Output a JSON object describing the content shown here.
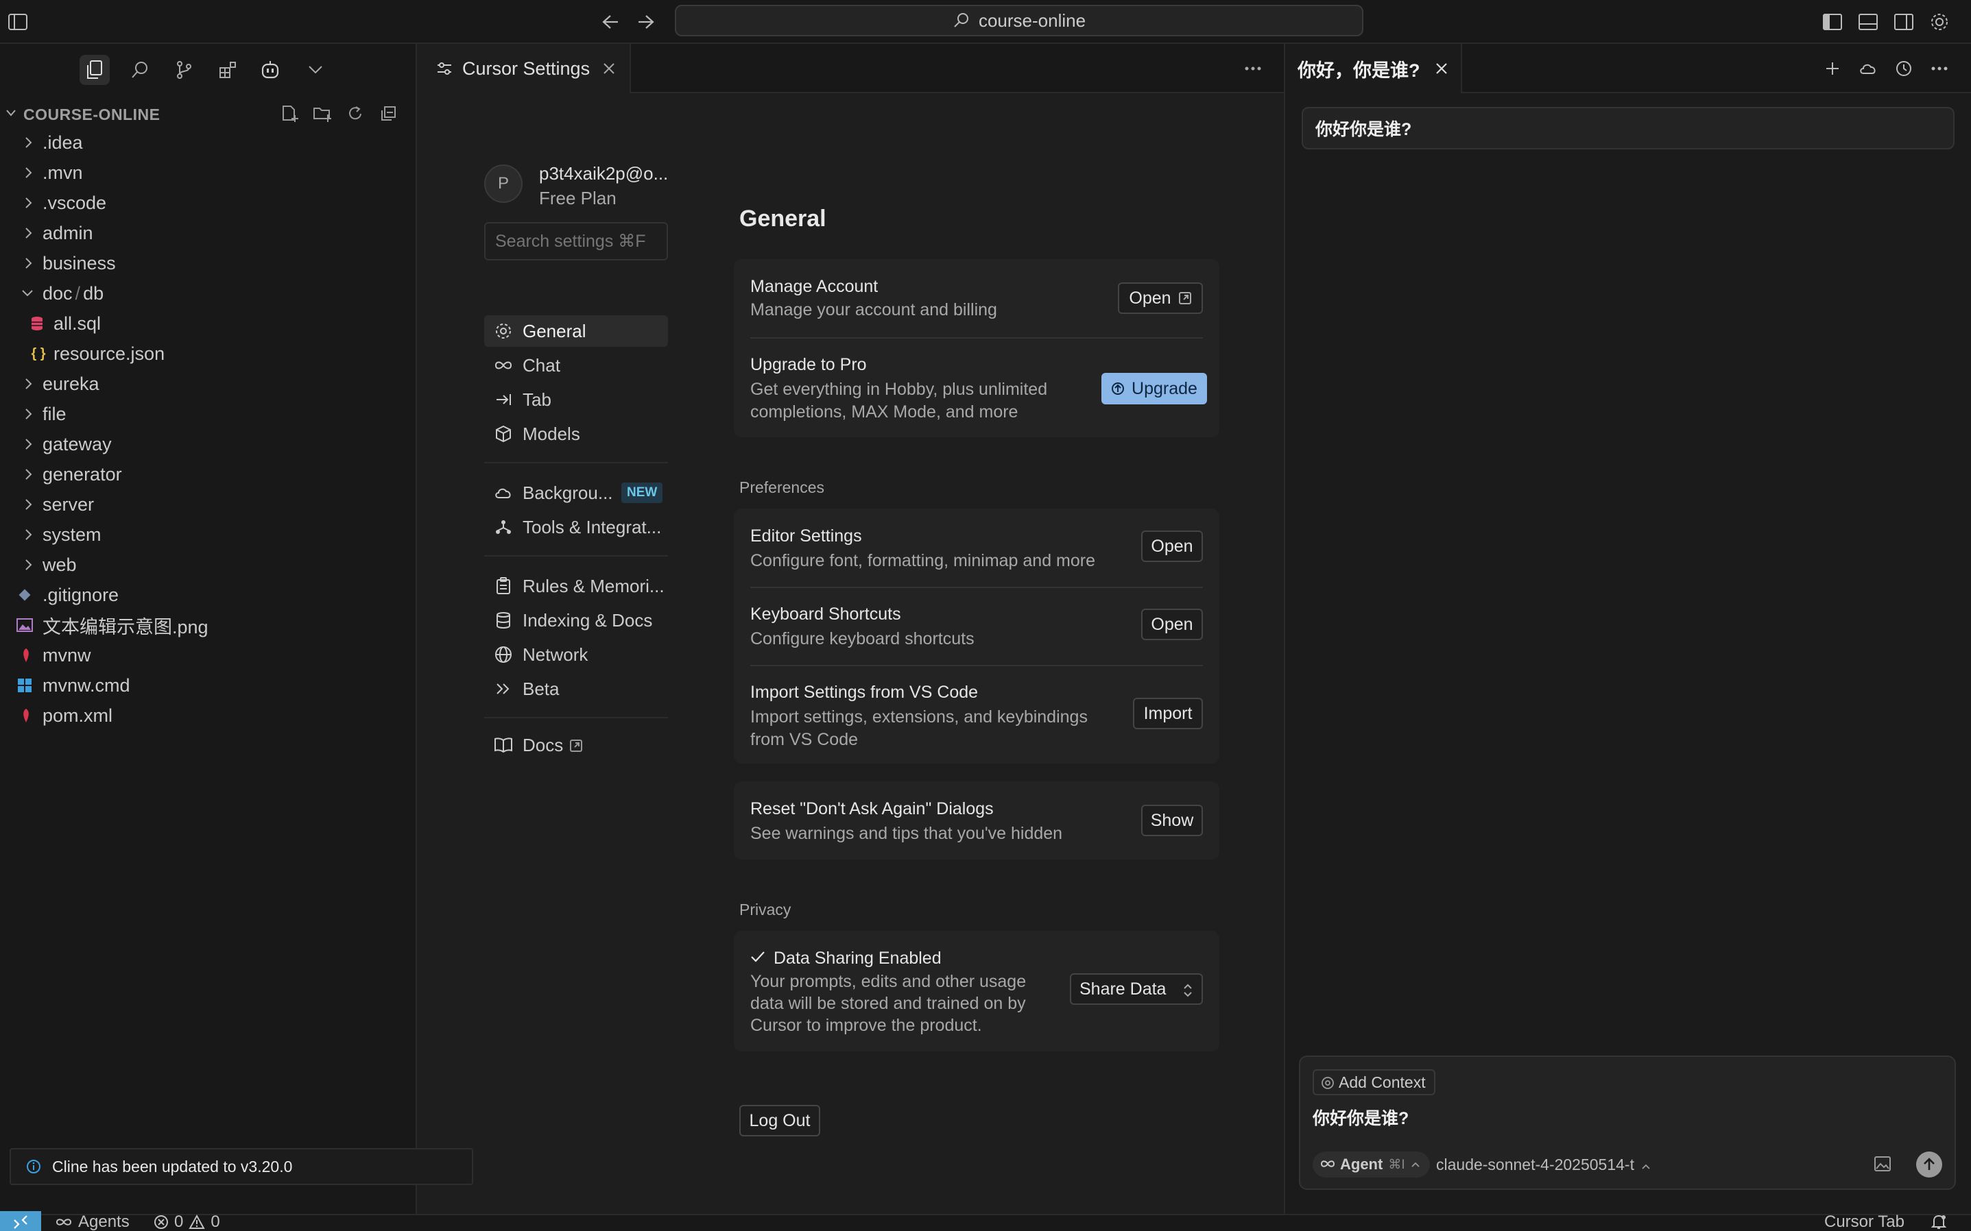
{
  "titlebar": {
    "search_text": "course-online"
  },
  "explorer": {
    "title": "COURSE-ONLINE",
    "items": [
      {
        "label": ".idea"
      },
      {
        "label": ".mvn"
      },
      {
        "label": ".vscode"
      },
      {
        "label": "admin"
      },
      {
        "label": "business"
      },
      {
        "label": "doc",
        "suffix": "db"
      },
      {
        "label": "all.sql"
      },
      {
        "label": "resource.json",
        "icon_text": "{ }"
      },
      {
        "label": "eureka"
      },
      {
        "label": "file"
      },
      {
        "label": "gateway"
      },
      {
        "label": "generator"
      },
      {
        "label": "server"
      },
      {
        "label": "system"
      },
      {
        "label": "web"
      },
      {
        "label": ".gitignore"
      },
      {
        "label": "文本编辑示意图.png"
      },
      {
        "label": "mvnw"
      },
      {
        "label": "mvnw.cmd"
      },
      {
        "label": "pom.xml"
      }
    ]
  },
  "toast": {
    "text": "Cline has been updated to v3.20.0"
  },
  "editor": {
    "tab_label": "Cursor Settings"
  },
  "settings": {
    "account": {
      "avatar_letter": "P",
      "email": "p3t4xaik2p@o...",
      "plan": "Free Plan"
    },
    "search_placeholder": "Search settings ⌘F",
    "nav": [
      {
        "label": "General"
      },
      {
        "label": "Chat"
      },
      {
        "label": "Tab"
      },
      {
        "label": "Models"
      },
      {
        "label": "Backgrou...",
        "badge": "NEW"
      },
      {
        "label": "Tools & Integrat..."
      },
      {
        "label": "Rules & Memori..."
      },
      {
        "label": "Indexing & Docs"
      },
      {
        "label": "Network"
      },
      {
        "label": "Beta"
      },
      {
        "label": "Docs"
      }
    ],
    "title": "General",
    "manage_account": {
      "title": "Manage Account",
      "desc": "Manage your account and billing",
      "button": "Open"
    },
    "upgrade": {
      "title": "Upgrade to Pro",
      "desc_line1": "Get everything in Hobby, plus unlimited",
      "desc_line2": "completions, MAX Mode, and more",
      "button": "Upgrade"
    },
    "preferences_label": "Preferences",
    "editor_settings": {
      "title": "Editor Settings",
      "desc": "Configure font, formatting, minimap and more",
      "button": "Open"
    },
    "keyboard_shortcuts": {
      "title": "Keyboard Shortcuts",
      "desc": "Configure keyboard shortcuts",
      "button": "Open"
    },
    "import_settings": {
      "title": "Import Settings from VS Code",
      "desc_line1": "Import settings, extensions, and keybindings",
      "desc_line2": "from VS Code",
      "button": "Import"
    },
    "reset_dialogs": {
      "title": "Reset \"Don't Ask Again\" Dialogs",
      "desc": "See warnings and tips that you've hidden",
      "button": "Show"
    },
    "privacy_label": "Privacy",
    "data_sharing": {
      "title": "Data Sharing Enabled",
      "desc_line1": "Your prompts, edits and other usage",
      "desc_line2": "data will be stored and trained on by",
      "desc_line3": "Cursor to improve the product.",
      "select": "Share Data"
    },
    "logout": "Log Out"
  },
  "chat": {
    "tab_title": "你好，你是谁?",
    "user_message": "你好你是谁?",
    "composer": {
      "add_context": "Add Context",
      "text": "你好你是谁?",
      "mode": "Agent",
      "mode_shortcut": "⌘I",
      "model": "claude-sonnet-4-20250514-t"
    }
  },
  "statusbar": {
    "agents": "Agents",
    "errors": "0",
    "warnings": "0",
    "right_label": "Cursor Tab"
  }
}
